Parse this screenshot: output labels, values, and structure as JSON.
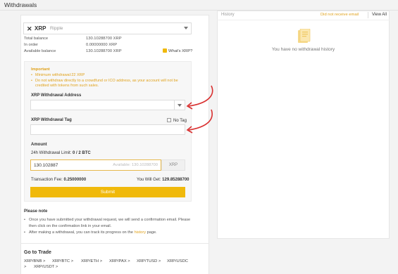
{
  "page": {
    "title": "Withdrawals"
  },
  "coin": {
    "symbol": "XRP",
    "name": "Ripple",
    "icon": "xrp-icon"
  },
  "balances": [
    {
      "label": "Total balance",
      "value": "130.10288700 XRP"
    },
    {
      "label": "In order",
      "value": "0.00000000 XRP"
    },
    {
      "label": "Available balance",
      "value": "130.10288700 XRP"
    }
  ],
  "whats_link": "What's XRP?",
  "important": {
    "title": "Important",
    "items": [
      "Minimum withdrawal:22 XRP",
      "Do not withdraw directly to a crowdfund or ICO address, as your account will not be",
      "credited with tokens from such sales."
    ]
  },
  "form": {
    "address_label": "XRP Withdrawal Address",
    "address_value": "",
    "tag_label": "XRP Withdrawal Tag",
    "tag_value": "",
    "no_tag_label": "No Tag",
    "amount_title": "Amount",
    "limit_label": "24h Withdrawal Limit:",
    "limit_value": "0 / 2 BTC",
    "amount_value": "130.102887",
    "amount_hint": "Available: 130.10288700",
    "amount_unit": "XRP",
    "fee_label": "Transaction Fee:",
    "fee_value": "0.25000000",
    "get_label": "You Will Get:",
    "get_value": "129.85288700",
    "submit_label": "Submit"
  },
  "note": {
    "title": "Please note",
    "line1": "Once you have submitted your withdrawal request, we will send a confirmation email. Please",
    "line2": "then click on the confirmation link in your email.",
    "line3_pre": "After making a withdrawal, you can track its progress on the",
    "line3_link": "history",
    "line3_post": "page."
  },
  "trade": {
    "title": "Go to Trade",
    "pairs": [
      "XRP/BNB >",
      "XRP/BTC >",
      "XRP/ETH >",
      "XRP/PAX >",
      "XRP/TUSD >",
      "XRP/USDC",
      ">",
      "XRP/USDT >"
    ]
  },
  "history": {
    "title": "History",
    "not_received": "Did not receive email",
    "view_all": "View All",
    "empty_text": "You have no withdrawal history"
  },
  "colors": {
    "accent": "#f0b90b",
    "warning": "#e0a21c",
    "annotation": "#d93030"
  }
}
